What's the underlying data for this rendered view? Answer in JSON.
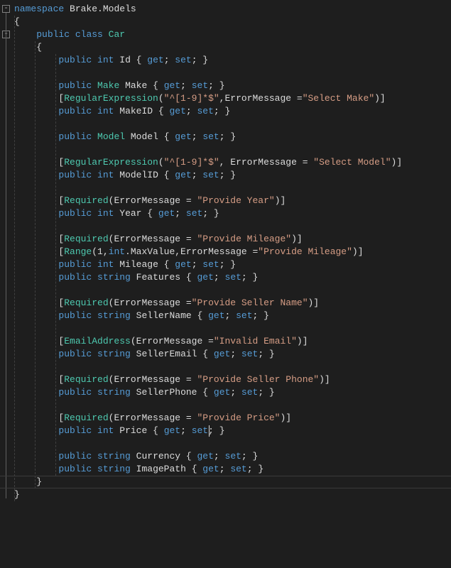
{
  "editor": {
    "caret_line_index": 37,
    "lines": [
      [
        [
          "kw",
          "namespace"
        ],
        [
          "punc",
          " "
        ],
        [
          "ident",
          "Brake"
        ],
        [
          "punc",
          "."
        ],
        [
          "ident",
          "Models"
        ]
      ],
      [
        [
          "punc",
          "{"
        ]
      ],
      [
        [
          "punc",
          "    "
        ],
        [
          "kw",
          "public"
        ],
        [
          "punc",
          " "
        ],
        [
          "kw",
          "class"
        ],
        [
          "punc",
          " "
        ],
        [
          "type",
          "Car"
        ]
      ],
      [
        [
          "punc",
          "    {"
        ]
      ],
      [
        [
          "punc",
          "        "
        ],
        [
          "kw",
          "public"
        ],
        [
          "punc",
          " "
        ],
        [
          "kw",
          "int"
        ],
        [
          "punc",
          " "
        ],
        [
          "ident",
          "Id"
        ],
        [
          "punc",
          " { "
        ],
        [
          "kw",
          "get"
        ],
        [
          "punc",
          "; "
        ],
        [
          "kw",
          "set"
        ],
        [
          "punc",
          "; }"
        ]
      ],
      [
        [
          "punc",
          ""
        ]
      ],
      [
        [
          "punc",
          "        "
        ],
        [
          "kw",
          "public"
        ],
        [
          "punc",
          " "
        ],
        [
          "type",
          "Make"
        ],
        [
          "punc",
          " "
        ],
        [
          "ident",
          "Make"
        ],
        [
          "punc",
          " { "
        ],
        [
          "kw",
          "get"
        ],
        [
          "punc",
          "; "
        ],
        [
          "kw",
          "set"
        ],
        [
          "punc",
          "; }"
        ]
      ],
      [
        [
          "punc",
          "        ["
        ],
        [
          "type",
          "RegularExpression"
        ],
        [
          "punc",
          "("
        ],
        [
          "str",
          "\"^[1-9]*$\""
        ],
        [
          "punc",
          ",ErrorMessage ="
        ],
        [
          "str",
          "\"Select Make\""
        ],
        [
          "punc",
          ")]"
        ]
      ],
      [
        [
          "punc",
          "        "
        ],
        [
          "kw",
          "public"
        ],
        [
          "punc",
          " "
        ],
        [
          "kw",
          "int"
        ],
        [
          "punc",
          " "
        ],
        [
          "ident",
          "MakeID"
        ],
        [
          "punc",
          " { "
        ],
        [
          "kw",
          "get"
        ],
        [
          "punc",
          "; "
        ],
        [
          "kw",
          "set"
        ],
        [
          "punc",
          "; }"
        ]
      ],
      [
        [
          "punc",
          ""
        ]
      ],
      [
        [
          "punc",
          "        "
        ],
        [
          "kw",
          "public"
        ],
        [
          "punc",
          " "
        ],
        [
          "type",
          "Model"
        ],
        [
          "punc",
          " "
        ],
        [
          "ident",
          "Model"
        ],
        [
          "punc",
          " { "
        ],
        [
          "kw",
          "get"
        ],
        [
          "punc",
          "; "
        ],
        [
          "kw",
          "set"
        ],
        [
          "punc",
          "; }"
        ]
      ],
      [
        [
          "punc",
          ""
        ]
      ],
      [
        [
          "punc",
          "        ["
        ],
        [
          "type",
          "RegularExpression"
        ],
        [
          "punc",
          "("
        ],
        [
          "str",
          "\"^[1-9]*$\""
        ],
        [
          "punc",
          ", ErrorMessage = "
        ],
        [
          "str",
          "\"Select Model\""
        ],
        [
          "punc",
          ")]"
        ]
      ],
      [
        [
          "punc",
          "        "
        ],
        [
          "kw",
          "public"
        ],
        [
          "punc",
          " "
        ],
        [
          "kw",
          "int"
        ],
        [
          "punc",
          " "
        ],
        [
          "ident",
          "ModelID"
        ],
        [
          "punc",
          " { "
        ],
        [
          "kw",
          "get"
        ],
        [
          "punc",
          "; "
        ],
        [
          "kw",
          "set"
        ],
        [
          "punc",
          "; }"
        ]
      ],
      [
        [
          "punc",
          ""
        ]
      ],
      [
        [
          "punc",
          "        ["
        ],
        [
          "type",
          "Required"
        ],
        [
          "punc",
          "(ErrorMessage = "
        ],
        [
          "str",
          "\"Provide Year\""
        ],
        [
          "punc",
          ")]"
        ]
      ],
      [
        [
          "punc",
          "        "
        ],
        [
          "kw",
          "public"
        ],
        [
          "punc",
          " "
        ],
        [
          "kw",
          "int"
        ],
        [
          "punc",
          " "
        ],
        [
          "ident",
          "Year"
        ],
        [
          "punc",
          " { "
        ],
        [
          "kw",
          "get"
        ],
        [
          "punc",
          "; "
        ],
        [
          "kw",
          "set"
        ],
        [
          "punc",
          "; }"
        ]
      ],
      [
        [
          "punc",
          ""
        ]
      ],
      [
        [
          "punc",
          "        ["
        ],
        [
          "type",
          "Required"
        ],
        [
          "punc",
          "(ErrorMessage = "
        ],
        [
          "str",
          "\"Provide Mileage\""
        ],
        [
          "punc",
          ")]"
        ]
      ],
      [
        [
          "punc",
          "        ["
        ],
        [
          "type",
          "Range"
        ],
        [
          "punc",
          "(1,"
        ],
        [
          "kw",
          "int"
        ],
        [
          "punc",
          ".MaxValue,ErrorMessage ="
        ],
        [
          "str",
          "\"Provide Mileage\""
        ],
        [
          "punc",
          ")]"
        ]
      ],
      [
        [
          "punc",
          "        "
        ],
        [
          "kw",
          "public"
        ],
        [
          "punc",
          " "
        ],
        [
          "kw",
          "int"
        ],
        [
          "punc",
          " "
        ],
        [
          "ident",
          "Mileage"
        ],
        [
          "punc",
          " { "
        ],
        [
          "kw",
          "get"
        ],
        [
          "punc",
          "; "
        ],
        [
          "kw",
          "set"
        ],
        [
          "punc",
          "; }"
        ]
      ],
      [
        [
          "punc",
          "        "
        ],
        [
          "kw",
          "public"
        ],
        [
          "punc",
          " "
        ],
        [
          "kw",
          "string"
        ],
        [
          "punc",
          " "
        ],
        [
          "ident",
          "Features"
        ],
        [
          "punc",
          " { "
        ],
        [
          "kw",
          "get"
        ],
        [
          "punc",
          "; "
        ],
        [
          "kw",
          "set"
        ],
        [
          "punc",
          "; }"
        ]
      ],
      [
        [
          "punc",
          ""
        ]
      ],
      [
        [
          "punc",
          "        ["
        ],
        [
          "type",
          "Required"
        ],
        [
          "punc",
          "(ErrorMessage ="
        ],
        [
          "str",
          "\"Provide Seller Name\""
        ],
        [
          "punc",
          ")]"
        ]
      ],
      [
        [
          "punc",
          "        "
        ],
        [
          "kw",
          "public"
        ],
        [
          "punc",
          " "
        ],
        [
          "kw",
          "string"
        ],
        [
          "punc",
          " "
        ],
        [
          "ident",
          "SellerName"
        ],
        [
          "punc",
          " { "
        ],
        [
          "kw",
          "get"
        ],
        [
          "punc",
          "; "
        ],
        [
          "kw",
          "set"
        ],
        [
          "punc",
          "; }"
        ]
      ],
      [
        [
          "punc",
          ""
        ]
      ],
      [
        [
          "punc",
          "        ["
        ],
        [
          "type",
          "EmailAddress"
        ],
        [
          "punc",
          "(ErrorMessage ="
        ],
        [
          "str",
          "\"Invalid Email\""
        ],
        [
          "punc",
          ")]"
        ]
      ],
      [
        [
          "punc",
          "        "
        ],
        [
          "kw",
          "public"
        ],
        [
          "punc",
          " "
        ],
        [
          "kw",
          "string"
        ],
        [
          "punc",
          " "
        ],
        [
          "ident",
          "SellerEmail"
        ],
        [
          "punc",
          " { "
        ],
        [
          "kw",
          "get"
        ],
        [
          "punc",
          "; "
        ],
        [
          "kw",
          "set"
        ],
        [
          "punc",
          "; }"
        ]
      ],
      [
        [
          "punc",
          ""
        ]
      ],
      [
        [
          "punc",
          "        ["
        ],
        [
          "type",
          "Required"
        ],
        [
          "punc",
          "(ErrorMessage = "
        ],
        [
          "str",
          "\"Provide Seller Phone\""
        ],
        [
          "punc",
          ")]"
        ]
      ],
      [
        [
          "punc",
          "        "
        ],
        [
          "kw",
          "public"
        ],
        [
          "punc",
          " "
        ],
        [
          "kw",
          "string"
        ],
        [
          "punc",
          " "
        ],
        [
          "ident",
          "SellerPhone"
        ],
        [
          "punc",
          " { "
        ],
        [
          "kw",
          "get"
        ],
        [
          "punc",
          "; "
        ],
        [
          "kw",
          "set"
        ],
        [
          "punc",
          "; }"
        ]
      ],
      [
        [
          "punc",
          ""
        ]
      ],
      [
        [
          "punc",
          "        ["
        ],
        [
          "type",
          "Required"
        ],
        [
          "punc",
          "(ErrorMessage = "
        ],
        [
          "str",
          "\"Provide Price\""
        ],
        [
          "punc",
          ")]"
        ]
      ],
      [
        [
          "punc",
          "        "
        ],
        [
          "kw",
          "public"
        ],
        [
          "punc",
          " "
        ],
        [
          "kw",
          "int"
        ],
        [
          "punc",
          " "
        ],
        [
          "ident",
          "Price"
        ],
        [
          "punc",
          " { "
        ],
        [
          "kw",
          "get"
        ],
        [
          "punc",
          "; "
        ],
        [
          "kw",
          "set"
        ],
        [
          "punc",
          "; }"
        ]
      ],
      [
        [
          "punc",
          ""
        ]
      ],
      [
        [
          "punc",
          "        "
        ],
        [
          "kw",
          "public"
        ],
        [
          "punc",
          " "
        ],
        [
          "kw",
          "string"
        ],
        [
          "punc",
          " "
        ],
        [
          "ident",
          "Currency"
        ],
        [
          "punc",
          " { "
        ],
        [
          "kw",
          "get"
        ],
        [
          "punc",
          "; "
        ],
        [
          "kw",
          "set"
        ],
        [
          "punc",
          "; }"
        ]
      ],
      [
        [
          "punc",
          "        "
        ],
        [
          "kw",
          "public"
        ],
        [
          "punc",
          " "
        ],
        [
          "kw",
          "string"
        ],
        [
          "punc",
          " "
        ],
        [
          "ident",
          "ImagePath"
        ],
        [
          "punc",
          " { "
        ],
        [
          "kw",
          "get"
        ],
        [
          "punc",
          "; "
        ],
        [
          "kw",
          "set"
        ],
        [
          "punc",
          "; }"
        ]
      ],
      [
        [
          "punc",
          "    }"
        ]
      ],
      [
        [
          "punc",
          "}"
        ]
      ]
    ],
    "fold_marks": [
      {
        "line": 0,
        "glyph": "-"
      },
      {
        "line": 2,
        "glyph": "-"
      }
    ],
    "indent_guides": [
      {
        "col": 0,
        "from": 1,
        "to": 38
      },
      {
        "col": 4,
        "from": 3,
        "to": 37
      },
      {
        "col": 8,
        "from": 4,
        "to": 36
      }
    ],
    "caret_col": 37
  }
}
